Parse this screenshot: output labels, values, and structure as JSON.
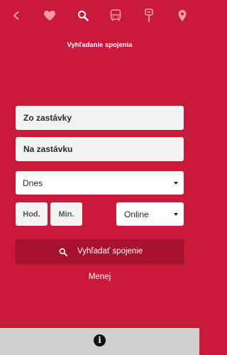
{
  "nav": {
    "items": [
      {
        "icon": "back-arrow-icon",
        "active": false
      },
      {
        "icon": "heart-icon",
        "active": false
      },
      {
        "icon": "search-icon",
        "active": true
      },
      {
        "icon": "bus-icon",
        "active": false
      },
      {
        "icon": "bus-stop-icon",
        "active": false
      },
      {
        "icon": "map-pin-icon",
        "active": false
      }
    ]
  },
  "header": {
    "title": "Vyhľadanie spojenia"
  },
  "form": {
    "from_placeholder": "Zo zastávky",
    "to_placeholder": "Na zastávku",
    "date_value": "Dnes",
    "hour_placeholder": "Hod.",
    "minute_placeholder": "Min.",
    "mode_value": "Online"
  },
  "actions": {
    "search_label": "Vyhľadať spojenie",
    "less_label": "Menej"
  },
  "colors": {
    "background": "#c91a3b",
    "search_button": "#a8112d",
    "icon_inactive": "#f59aa8",
    "icon_active": "#ffffff",
    "footer": "#d0d0d0"
  },
  "footer": {
    "info_glyph": "i"
  }
}
